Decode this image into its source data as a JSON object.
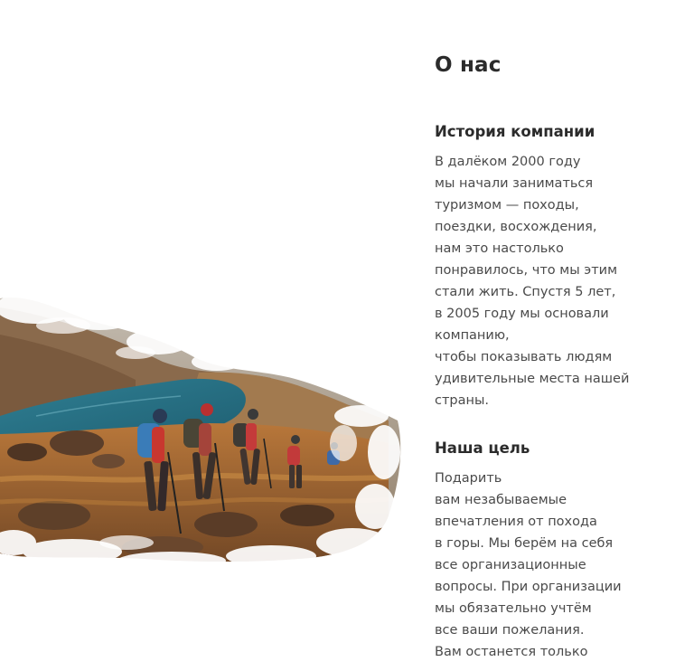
{
  "page": {
    "title": "О нас"
  },
  "sections": [
    {
      "title": "История компании",
      "lines": [
        "В далёком 2000 году",
        "мы начали заниматься",
        "туризмом — походы,",
        "поездки, восхождения,",
        "нам это настолько",
        "понравилось, что мы этим",
        "стали жить. Спустя 5 лет,",
        "в 2005 году мы основали",
        "компанию,",
        "чтобы показывать людям",
        "удивительные места нашей",
        "страны."
      ]
    },
    {
      "title": "Наша цель",
      "lines": [
        "Подарить",
        "вам незабываемые",
        "впечатления от похода",
        "в горы. Мы берём на себя",
        "все организационные",
        "вопросы. При организации",
        "мы обязательно учтём",
        "все ваши пожелания.",
        "Вам останется только"
      ]
    }
  ],
  "colors": {
    "heading": "#2b2b2b",
    "body_text": "#4a4a4a",
    "lake": "#2f7f93",
    "terrain": "#a8652c"
  }
}
